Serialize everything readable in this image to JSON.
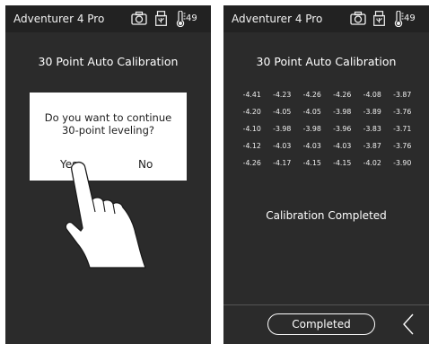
{
  "left_screen": {
    "title": "Adventurer 4 Pro",
    "temperature": "49",
    "heading": "30 Point Auto Calibration",
    "dialog": {
      "message_line1": "Do you want to continue",
      "message_line2": "30-point leveling?",
      "yes_label": "Yes",
      "no_label": "No"
    }
  },
  "right_screen": {
    "title": "Adventurer 4 Pro",
    "temperature": "49",
    "heading": "30 Point Auto Calibration",
    "calibration_values": [
      [
        "-4.41",
        "-4.23",
        "-4.26",
        "-4.26",
        "-4.08",
        "-3.87"
      ],
      [
        "-4.20",
        "-4.05",
        "-4.05",
        "-3.98",
        "-3.89",
        "-3.76"
      ],
      [
        "-4.10",
        "-3.98",
        "-3.98",
        "-3.96",
        "-3.83",
        "-3.71"
      ],
      [
        "-4.12",
        "-4.03",
        "-4.03",
        "-4.03",
        "-3.87",
        "-3.76"
      ],
      [
        "-4.26",
        "-4.17",
        "-4.15",
        "-4.15",
        "-4.02",
        "-3.90"
      ]
    ],
    "status_message": "Calibration Completed",
    "completed_label": "Completed"
  },
  "icons": {
    "camera": "camera-icon",
    "usb": "usb-icon",
    "thermometer": "thermometer-icon",
    "back": "chevron-left-icon",
    "hand": "pointing-hand-icon"
  }
}
